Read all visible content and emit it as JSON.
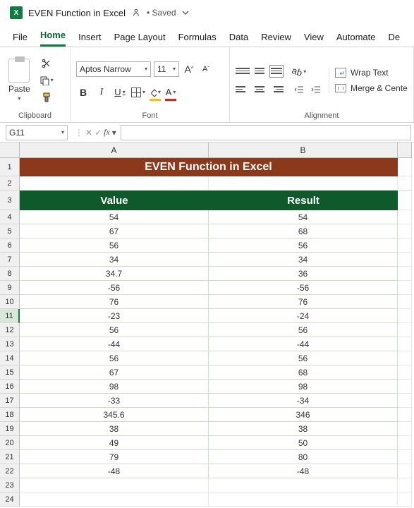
{
  "titlebar": {
    "filename": "EVEN Function in Excel",
    "saved_label": "• Saved"
  },
  "tabs": {
    "file": "File",
    "home": "Home",
    "insert": "Insert",
    "page_layout": "Page Layout",
    "formulas": "Formulas",
    "data": "Data",
    "review": "Review",
    "view": "View",
    "automate": "Automate",
    "dev": "De"
  },
  "ribbon": {
    "clipboard": {
      "paste": "Paste",
      "group_label": "Clipboard"
    },
    "font": {
      "name": "Aptos Narrow",
      "size": "11",
      "group_label": "Font"
    },
    "alignment": {
      "wrap": "Wrap Text",
      "merge": "Merge & Cente",
      "group_label": "Alignment"
    }
  },
  "formula_bar": {
    "cell_ref": "G11",
    "fx": "fx",
    "value": ""
  },
  "columns": {
    "A": "A",
    "B": "B"
  },
  "sheet": {
    "title": "EVEN Function in Excel",
    "header_value": "Value",
    "header_result": "Result",
    "rows": [
      {
        "v": "54",
        "r": "54"
      },
      {
        "v": "67",
        "r": "68"
      },
      {
        "v": "56",
        "r": "56"
      },
      {
        "v": "34",
        "r": "34"
      },
      {
        "v": "34.7",
        "r": "36"
      },
      {
        "v": "-56",
        "r": "-56"
      },
      {
        "v": "76",
        "r": "76"
      },
      {
        "v": "-23",
        "r": "-24"
      },
      {
        "v": "56",
        "r": "56"
      },
      {
        "v": "-44",
        "r": "-44"
      },
      {
        "v": "56",
        "r": "56"
      },
      {
        "v": "67",
        "r": "68"
      },
      {
        "v": "98",
        "r": "98"
      },
      {
        "v": "-33",
        "r": "-34"
      },
      {
        "v": "345.6",
        "r": "346"
      },
      {
        "v": "38",
        "r": "38"
      },
      {
        "v": "49",
        "r": "50"
      },
      {
        "v": "79",
        "r": "80"
      },
      {
        "v": "-48",
        "r": "-48"
      }
    ]
  },
  "row_numbers": [
    "1",
    "2",
    "3",
    "4",
    "5",
    "6",
    "7",
    "8",
    "9",
    "10",
    "11",
    "12",
    "13",
    "14",
    "15",
    "16",
    "17",
    "18",
    "19",
    "20",
    "21",
    "22",
    "23",
    "24"
  ]
}
